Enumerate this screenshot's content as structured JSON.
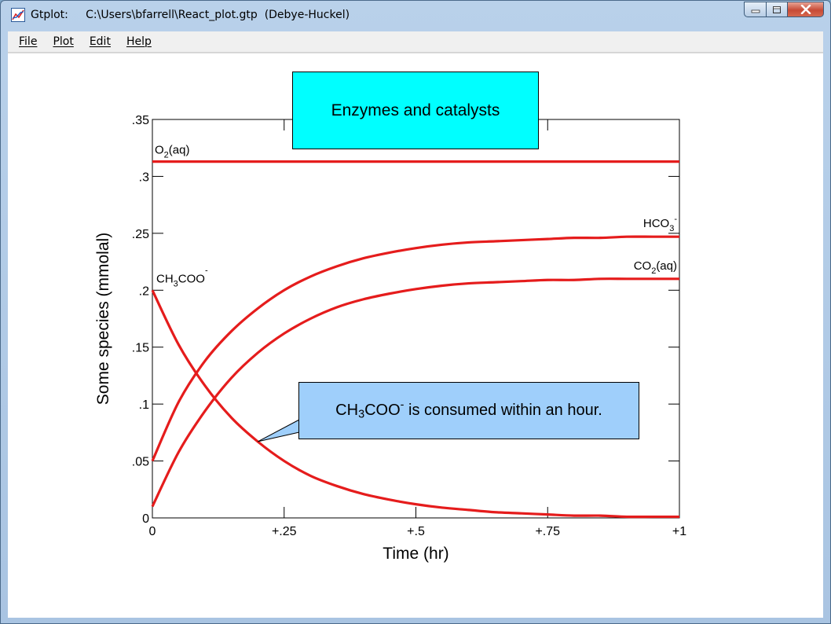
{
  "window": {
    "app_name": "Gtplot:",
    "file_path": "C:\\Users\\bfarrell\\React_plot.gtp",
    "model": "(Debye-Huckel)"
  },
  "menu": [
    "File",
    "Plot",
    "Edit",
    "Help"
  ],
  "colors": {
    "curve": "#e51c1c",
    "title_box": "#00ffff",
    "callout_box": "#9fcffb"
  },
  "annotations": {
    "title": "Enzymes and catalysts",
    "callout_prefix": "CH",
    "callout_sub": "3",
    "callout_mid": "COO",
    "callout_sup": "-",
    "callout_suffix": " is consumed within an hour."
  },
  "chart_data": {
    "type": "line",
    "xlabel": "Time (hr)",
    "ylabel": "Some species (mmolal)",
    "xlim": [
      0,
      1
    ],
    "ylim": [
      0,
      0.35
    ],
    "xticks": [
      "0",
      "+.25",
      "+.5",
      "+.75",
      "+1"
    ],
    "yticks": [
      "0",
      ".05",
      ".1",
      ".15",
      ".2",
      ".25",
      ".3",
      ".35"
    ],
    "grid": false,
    "x": [
      0,
      0.05,
      0.1,
      0.15,
      0.2,
      0.25,
      0.3,
      0.35,
      0.4,
      0.45,
      0.5,
      0.55,
      0.6,
      0.65,
      0.7,
      0.75,
      0.8,
      0.85,
      0.9,
      0.95,
      1.0
    ],
    "series": [
      {
        "name": "O2(aq)",
        "label_base": "O",
        "label_sub": "2",
        "label_sup": "",
        "label_tail": "(aq)",
        "values": [
          0.313,
          0.313,
          0.313,
          0.313,
          0.313,
          0.313,
          0.313,
          0.313,
          0.313,
          0.313,
          0.313,
          0.313,
          0.313,
          0.313,
          0.313,
          0.313,
          0.313,
          0.313,
          0.313,
          0.313,
          0.313
        ]
      },
      {
        "name": "HCO3-",
        "label_base": "HCO",
        "label_sub": "3",
        "label_sup": "-",
        "label_tail": "",
        "values": [
          0.05,
          0.102,
          0.138,
          0.164,
          0.184,
          0.2,
          0.212,
          0.221,
          0.228,
          0.233,
          0.237,
          0.24,
          0.242,
          0.243,
          0.244,
          0.245,
          0.246,
          0.246,
          0.247,
          0.247,
          0.247
        ]
      },
      {
        "name": "CO2(aq)",
        "label_base": "CO",
        "label_sub": "2",
        "label_sup": "",
        "label_tail": "(aq)",
        "values": [
          0.01,
          0.058,
          0.094,
          0.123,
          0.145,
          0.162,
          0.175,
          0.185,
          0.192,
          0.197,
          0.201,
          0.204,
          0.206,
          0.207,
          0.208,
          0.209,
          0.209,
          0.21,
          0.21,
          0.21,
          0.21
        ]
      },
      {
        "name": "CH3COO-",
        "label_base": "CH",
        "label_sub": "3",
        "label_sup": "-",
        "label_tail": "COO",
        "values": [
          0.2,
          0.152,
          0.116,
          0.088,
          0.067,
          0.05,
          0.037,
          0.028,
          0.021,
          0.016,
          0.012,
          0.009,
          0.007,
          0.005,
          0.004,
          0.003,
          0.002,
          0.002,
          0.001,
          0.001,
          0.001
        ]
      }
    ]
  }
}
